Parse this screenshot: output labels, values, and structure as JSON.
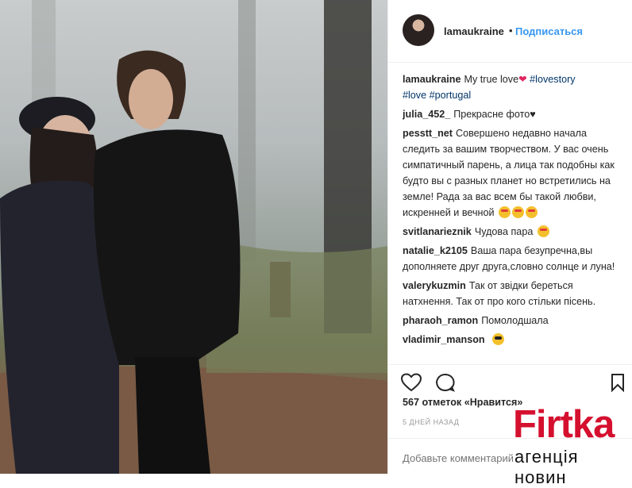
{
  "post": {
    "author": "lamaukraine",
    "dot": "•",
    "follow_label": "Подписаться"
  },
  "caption": {
    "user": "lamaukraine",
    "text": "My true love",
    "hashtags": [
      "#lovestory",
      "#love",
      "#portugal"
    ]
  },
  "comments": [
    {
      "user": "julia_452_",
      "text": "Прекрасне фото",
      "suffix": "♥"
    },
    {
      "user": "pesstt_net",
      "text": "Совершено недавно начала следить за вашим творчеством. У вас очень симпатичный парень, а лица так подобны как будто вы с разных планет но встретились на земле! Рада за вас всем бы такой любви, искренней и вечной"
    },
    {
      "user": "svitlanarieznik",
      "text": "Чудова пара"
    },
    {
      "user": "natalie_k2105",
      "text": "Ваша пара безупречна,вы дополняете друг друга,словно солнце и луна!"
    },
    {
      "user": "valerykuzmin",
      "text": "Так от звідки береться натхнення. Так от про кого стільки пісень."
    },
    {
      "user": "pharaoh_ramon",
      "text": "Помолодшала"
    },
    {
      "user": "vladimir_manson",
      "text": ""
    }
  ],
  "actions": {
    "like_icon": "heart-icon",
    "comment_icon": "comment-icon",
    "save_icon": "bookmark-icon"
  },
  "likes_text": "567 отметок «Нравится»",
  "timestamp": "5 ДНЕЙ НАЗАД",
  "add_comment_placeholder": "Добавьте комментарий...",
  "watermark": {
    "brand": "Firtka",
    "sub": "агенція новин"
  },
  "colors": {
    "link": "#3897f0",
    "brand_red": "#d5102f"
  }
}
